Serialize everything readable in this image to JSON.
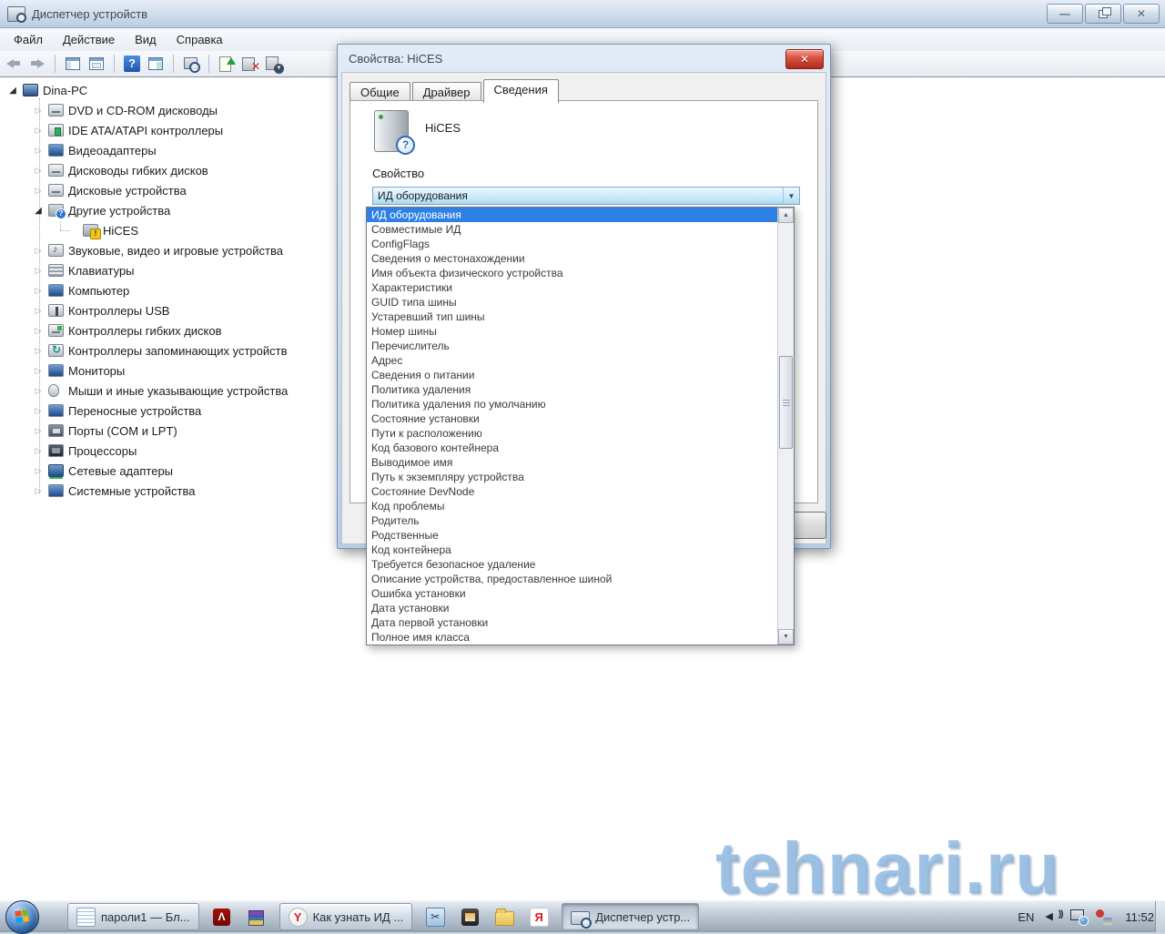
{
  "window": {
    "title": "Диспетчер устройств"
  },
  "menu": {
    "items": [
      {
        "label": "Файл"
      },
      {
        "label": "Действие"
      },
      {
        "label": "Вид"
      },
      {
        "label": "Справка"
      }
    ]
  },
  "toolbar": {
    "icons": [
      {
        "name": "back-icon",
        "cls": "tbi tb-back"
      },
      {
        "name": "forward-icon",
        "cls": "tbi tb-fwd"
      },
      {
        "name": "toolbar-separator",
        "cls": "tb-sep"
      },
      {
        "name": "show-console-tree-icon",
        "cls": "tbi tb-win tb-win1"
      },
      {
        "name": "properties-window-icon",
        "cls": "tbi tb-win tb-win2"
      },
      {
        "name": "toolbar-separator",
        "cls": "tb-sep"
      },
      {
        "name": "help-icon",
        "cls": "tbi tb-help"
      },
      {
        "name": "action-pane-icon",
        "cls": "tbi tb-win tb-win3"
      },
      {
        "name": "toolbar-separator",
        "cls": "tb-sep"
      },
      {
        "name": "scan-hardware-changes-icon",
        "cls": "tbi tb-scan"
      },
      {
        "name": "toolbar-separator",
        "cls": "tb-sep"
      },
      {
        "name": "update-driver-icon",
        "cls": "tbi tb-upd"
      },
      {
        "name": "uninstall-device-icon",
        "cls": "tbi tb-del"
      },
      {
        "name": "disable-device-icon",
        "cls": "tbi tb-dis"
      }
    ]
  },
  "tree": {
    "items": [
      {
        "label": "Dina-PC",
        "icon": "computer-icon",
        "cls": "lvl0 expanded",
        "ic": "ti-computer"
      },
      {
        "label": "DVD и CD-ROM дисководы",
        "icon": "dvd-drive-icon",
        "cls": "lvl1",
        "ic": "ti-dvd"
      },
      {
        "label": "IDE ATA/ATAPI контроллеры",
        "icon": "ide-controller-icon",
        "cls": "lvl1",
        "ic": "ti-ide"
      },
      {
        "label": "Видеоадаптеры",
        "icon": "display-adapter-icon",
        "cls": "lvl1",
        "ic": "ti-video"
      },
      {
        "label": "Дисководы гибких дисков",
        "icon": "floppy-drive-icon",
        "cls": "lvl1",
        "ic": "ti-floppy"
      },
      {
        "label": "Дисковые устройства",
        "icon": "disk-drive-icon",
        "cls": "lvl1",
        "ic": "ti-disk"
      },
      {
        "label": "Другие устройства",
        "icon": "other-devices-icon",
        "cls": "lvl1 expanded",
        "ic": "ti-other"
      },
      {
        "label": "HiCES",
        "icon": "unknown-device-warning-icon",
        "cls": "lvl2 leaf",
        "ic": "ti-hices"
      },
      {
        "label": "Звуковые, видео и игровые устройства",
        "icon": "sound-video-game-icon",
        "cls": "lvl1",
        "ic": "ti-sound"
      },
      {
        "label": "Клавиатуры",
        "icon": "keyboard-icon",
        "cls": "lvl1",
        "ic": "ti-keyboard"
      },
      {
        "label": "Компьютер",
        "icon": "computer-icon",
        "cls": "lvl1",
        "ic": "ti-computer2"
      },
      {
        "label": "Контроллеры USB",
        "icon": "usb-controller-icon",
        "cls": "lvl1",
        "ic": "ti-usb"
      },
      {
        "label": "Контроллеры гибких дисков",
        "icon": "floppy-controller-icon",
        "cls": "lvl1",
        "ic": "ti-floppyctl"
      },
      {
        "label": "Контроллеры запоминающих устройств",
        "icon": "storage-controller-icon",
        "cls": "lvl1",
        "ic": "ti-storage"
      },
      {
        "label": "Мониторы",
        "icon": "monitor-icon",
        "cls": "lvl1",
        "ic": "ti-monitor"
      },
      {
        "label": "Мыши и иные указывающие устройства",
        "icon": "mouse-icon",
        "cls": "lvl1",
        "ic": "ti-mouse"
      },
      {
        "label": "Переносные устройства",
        "icon": "portable-devices-icon",
        "cls": "lvl1",
        "ic": "ti-portable"
      },
      {
        "label": "Порты (COM и LPT)",
        "icon": "ports-icon",
        "cls": "lvl1",
        "ic": "ti-ports"
      },
      {
        "label": "Процессоры",
        "icon": "processor-icon",
        "cls": "lvl1",
        "ic": "ti-cpu"
      },
      {
        "label": "Сетевые адаптеры",
        "icon": "network-adapter-icon",
        "cls": "lvl1",
        "ic": "ti-net"
      },
      {
        "label": "Системные устройства",
        "icon": "system-devices-icon",
        "cls": "lvl1",
        "ic": "ti-sys"
      }
    ]
  },
  "dialog": {
    "title": "Свойства: HiCES",
    "close_glyph": "✕",
    "tabs": [
      {
        "label": "Общие",
        "cls": ""
      },
      {
        "label": "Драйвер",
        "cls": ""
      },
      {
        "label": "Сведения",
        "cls": "active"
      }
    ],
    "device_name": "HiCES",
    "property_label": "Свойство",
    "combobox_value": "ИД оборудования"
  },
  "dropdown": {
    "items": [
      {
        "t": "ИД оборудования",
        "c": "selected"
      },
      {
        "t": "Совместимые ИД",
        "c": ""
      },
      {
        "t": "ConfigFlags",
        "c": ""
      },
      {
        "t": "Сведения о местонахождении",
        "c": ""
      },
      {
        "t": "Имя объекта физического устройства",
        "c": ""
      },
      {
        "t": "Характеристики",
        "c": ""
      },
      {
        "t": "GUID типа шины",
        "c": ""
      },
      {
        "t": "Устаревший тип шины",
        "c": ""
      },
      {
        "t": "Номер шины",
        "c": ""
      },
      {
        "t": "Перечислитель",
        "c": ""
      },
      {
        "t": "Адрес",
        "c": ""
      },
      {
        "t": "Сведения о питании",
        "c": ""
      },
      {
        "t": "Политика удаления",
        "c": ""
      },
      {
        "t": "Политика удаления по умолчанию",
        "c": ""
      },
      {
        "t": "Состояние установки",
        "c": ""
      },
      {
        "t": "Пути к расположению",
        "c": ""
      },
      {
        "t": "Код базового контейнера",
        "c": ""
      },
      {
        "t": "Выводимое имя",
        "c": ""
      },
      {
        "t": "Путь к экземпляру устройства",
        "c": ""
      },
      {
        "t": "Состояние DevNode",
        "c": ""
      },
      {
        "t": "Код проблемы",
        "c": ""
      },
      {
        "t": "Родитель",
        "c": ""
      },
      {
        "t": "Родственные",
        "c": ""
      },
      {
        "t": "Код контейнера",
        "c": ""
      },
      {
        "t": "Требуется безопасное удаление",
        "c": ""
      },
      {
        "t": "Описание устройства, предоставленное шиной",
        "c": ""
      },
      {
        "t": "Ошибка установки",
        "c": ""
      },
      {
        "t": "Дата установки",
        "c": ""
      },
      {
        "t": "Дата первой установки",
        "c": ""
      },
      {
        "t": "Полное имя класса",
        "c": ""
      }
    ]
  },
  "taskbar": {
    "buttons": [
      {
        "label": "пароли1 — Бл...",
        "icon": "notepad-icon",
        "cls": "tk-btn",
        "ic": "ic-notepad"
      },
      {
        "label": "",
        "icon": "adobe-reader-icon",
        "cls": "tk-ico",
        "ic": "ic-adobe"
      },
      {
        "label": "",
        "icon": "winrar-icon",
        "cls": "tk-ico",
        "ic": "ic-winrar"
      },
      {
        "label": "Как узнать ИД ...",
        "icon": "yandex-browser-icon",
        "cls": "tk-btn",
        "ic": "ic-ybrowser"
      },
      {
        "label": "",
        "icon": "snipping-tool-icon",
        "cls": "tk-ico",
        "ic": "ic-snip"
      },
      {
        "label": "",
        "icon": "photo-viewer-icon",
        "cls": "tk-ico",
        "ic": "ic-photo"
      },
      {
        "label": "",
        "icon": "explorer-folder-icon",
        "cls": "tk-ico",
        "ic": "ic-folder"
      },
      {
        "label": "",
        "icon": "yandex-icon",
        "cls": "tk-ico",
        "ic": "ic-ya"
      },
      {
        "label": "Диспетчер устр...",
        "icon": "device-manager-icon",
        "cls": "tk-btn active",
        "ic": "ic-devmgr"
      }
    ],
    "tray": {
      "lang": "EN",
      "time": "11:52",
      "icons": [
        {
          "name": "volume-icon",
          "ic": "tr-vol"
        },
        {
          "name": "network-icon",
          "ic": "tr-net"
        },
        {
          "name": "tray-app-icon",
          "ic": "tr-app"
        }
      ]
    }
  },
  "watermark": {
    "text": "tehnari.ru"
  }
}
